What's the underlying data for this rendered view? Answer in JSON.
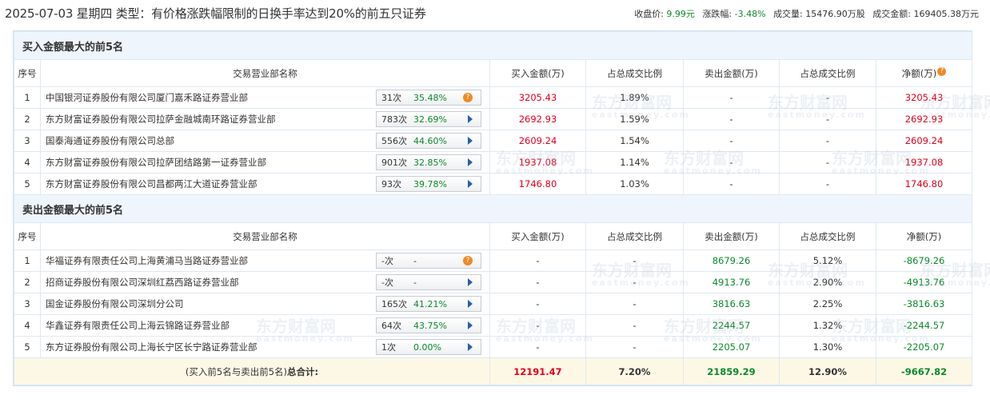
{
  "header": {
    "title": "2025-07-03 星期四 类型：有价格涨跌幅限制的日换手率达到20%的前五只证券",
    "close_label": "收盘价:",
    "close_value": "9.99元",
    "change_label": "涨跌幅:",
    "change_value": "-3.48%",
    "volume_label": "成交量:",
    "volume_value": "15476.90万股",
    "turnover_label": "成交金额:",
    "turnover_value": "169405.38万元"
  },
  "columns": {
    "seq": "序号",
    "name": "交易营业部名称",
    "buy": "买入金额(万)",
    "buy_pct": "占总成交比例",
    "sell": "卖出金额(万)",
    "sell_pct": "占总成交比例",
    "net": "净额(万)"
  },
  "buy_section": {
    "title": "买入金额最大的前5名",
    "rows": [
      {
        "seq": "1",
        "name": "中国银河证券股份有限公司厦门嘉禾路证券营业部",
        "count": "31次",
        "rate": "35.48%",
        "icon": "question-icon",
        "buy": "3205.43",
        "buy_pct": "1.89%",
        "sell": "-",
        "sell_pct": "-",
        "net": "3205.43"
      },
      {
        "seq": "2",
        "name": "东方财富证券股份有限公司拉萨金融城南环路证券营业部",
        "count": "783次",
        "rate": "32.69%",
        "icon": "play-icon",
        "buy": "2692.93",
        "buy_pct": "1.59%",
        "sell": "-",
        "sell_pct": "-",
        "net": "2692.93"
      },
      {
        "seq": "3",
        "name": "国泰海通证券股份有限公司总部",
        "count": "556次",
        "rate": "44.60%",
        "icon": "play-icon",
        "buy": "2609.24",
        "buy_pct": "1.54%",
        "sell": "-",
        "sell_pct": "-",
        "net": "2609.24"
      },
      {
        "seq": "4",
        "name": "东方财富证券股份有限公司拉萨团结路第一证券营业部",
        "count": "901次",
        "rate": "32.85%",
        "icon": "play-icon",
        "buy": "1937.08",
        "buy_pct": "1.14%",
        "sell": "-",
        "sell_pct": "-",
        "net": "1937.08"
      },
      {
        "seq": "5",
        "name": "东方财富证券股份有限公司昌都两江大道证券营业部",
        "count": "93次",
        "rate": "39.78%",
        "icon": "play-icon",
        "buy": "1746.80",
        "buy_pct": "1.03%",
        "sell": "-",
        "sell_pct": "-",
        "net": "1746.80"
      }
    ]
  },
  "sell_section": {
    "title": "卖出金额最大的前5名",
    "rows": [
      {
        "seq": "1",
        "name": "华福证券有限责任公司上海黄浦马当路证券营业部",
        "count": "-次",
        "rate": "-",
        "icon": "question-icon",
        "buy": "-",
        "buy_pct": "-",
        "sell": "8679.26",
        "sell_pct": "5.12%",
        "net": "-8679.26"
      },
      {
        "seq": "2",
        "name": "招商证券股份有限公司深圳红荔西路证券营业部",
        "count": "-次",
        "rate": "-",
        "icon": "play-icon",
        "buy": "-",
        "buy_pct": "-",
        "sell": "4913.76",
        "sell_pct": "2.90%",
        "net": "-4913.76"
      },
      {
        "seq": "3",
        "name": "国金证券股份有限公司深圳分公司",
        "count": "165次",
        "rate": "41.21%",
        "icon": "play-icon",
        "buy": "-",
        "buy_pct": "-",
        "sell": "3816.63",
        "sell_pct": "2.25%",
        "net": "-3816.63"
      },
      {
        "seq": "4",
        "name": "华鑫证券有限责任公司上海云锦路证券营业部",
        "count": "64次",
        "rate": "43.75%",
        "icon": "play-icon",
        "buy": "-",
        "buy_pct": "-",
        "sell": "2244.57",
        "sell_pct": "1.32%",
        "net": "-2244.57"
      },
      {
        "seq": "5",
        "name": "东方证券股份有限公司上海长宁区长宁路证券营业部",
        "count": "1次",
        "rate": "0.00%",
        "icon": "play-icon",
        "buy": "-",
        "buy_pct": "-",
        "sell": "2205.07",
        "sell_pct": "1.30%",
        "net": "-2205.07"
      }
    ]
  },
  "total": {
    "label_prefix": "(买入前5名与卖出前5名)",
    "label_bold": "总合计:",
    "buy": "12191.47",
    "buy_pct": "7.20%",
    "sell": "21859.29",
    "sell_pct": "12.90%",
    "net": "-9667.82"
  },
  "watermark": {
    "cn": "东方财富网",
    "en": "eastmoney.com"
  },
  "colors": {
    "positive": "#e3001b",
    "negative": "#0a8a2a",
    "section_bg": "#eef5fc",
    "total_bg": "#fdf8e6"
  }
}
